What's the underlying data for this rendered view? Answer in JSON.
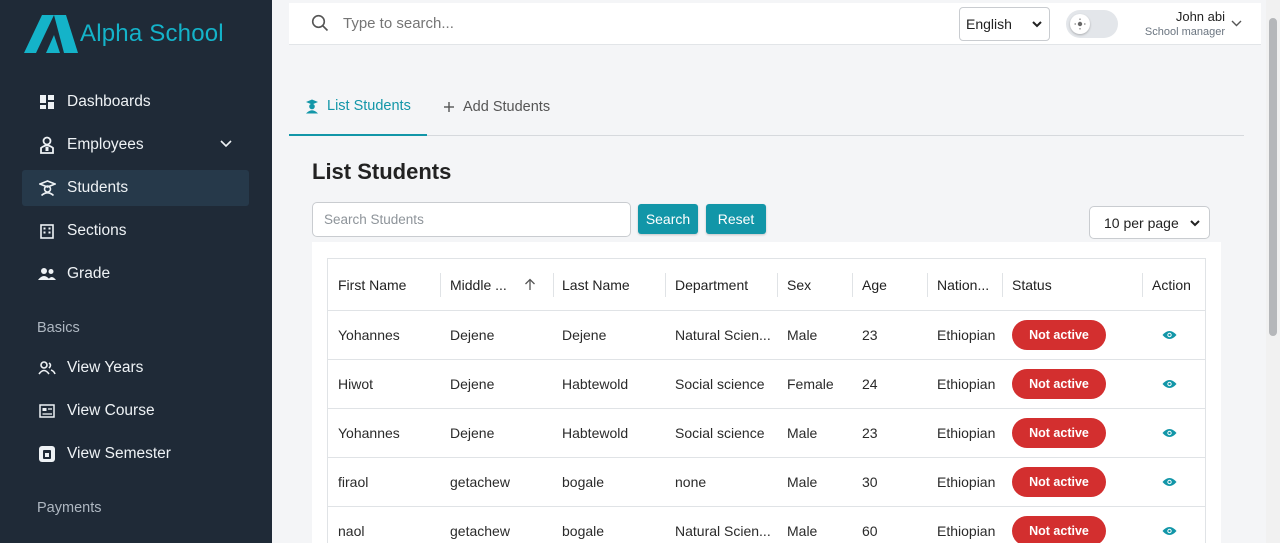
{
  "app": {
    "name": "Alpha School"
  },
  "sidebar": {
    "items": [
      {
        "label": "Dashboards",
        "icon": "dashboard-icon"
      },
      {
        "label": "Employees",
        "icon": "employee-icon"
      },
      {
        "label": "Students",
        "icon": "student-icon"
      },
      {
        "label": "Sections",
        "icon": "building-icon"
      },
      {
        "label": "Grade",
        "icon": "group-icon"
      }
    ],
    "basics_label": "Basics",
    "basics_items": [
      {
        "label": "View Years",
        "icon": "people-icon"
      },
      {
        "label": "View Course",
        "icon": "course-icon"
      },
      {
        "label": "View Semester",
        "icon": "semester-icon"
      }
    ],
    "payments_label": "Payments"
  },
  "topbar": {
    "search_placeholder": "Type to search...",
    "language": "English",
    "user_name": "John abi",
    "user_role": "School manager"
  },
  "tabs": {
    "list": "List Students",
    "add": "Add Students"
  },
  "page": {
    "title": "List Students",
    "search_placeholder": "Search Students",
    "search_button": "Search",
    "reset_button": "Reset",
    "per_page": "10 per page"
  },
  "table": {
    "headers": [
      "First Name",
      "Middle ...",
      "Last Name",
      "Department",
      "Sex",
      "Age",
      "Nation...",
      "Status",
      "Action"
    ],
    "rows": [
      {
        "first": "Yohannes",
        "middle": "Dejene",
        "last": "Dejene",
        "dept": "Natural Scien...",
        "sex": "Male",
        "age": "23",
        "nation": "Ethiopian",
        "status": "Not active"
      },
      {
        "first": "Hiwot",
        "middle": "Dejene",
        "last": "Habtewold",
        "dept": "Social science",
        "sex": "Female",
        "age": "24",
        "nation": "Ethiopian",
        "status": "Not active"
      },
      {
        "first": "Yohannes",
        "middle": "Dejene",
        "last": "Habtewold",
        "dept": "Social science",
        "sex": "Male",
        "age": "23",
        "nation": "Ethiopian",
        "status": "Not active"
      },
      {
        "first": "firaol",
        "middle": "getachew",
        "last": "bogale",
        "dept": "none",
        "sex": "Male",
        "age": "30",
        "nation": "Ethiopian",
        "status": "Not active"
      },
      {
        "first": "naol",
        "middle": "getachew",
        "last": "bogale",
        "dept": "Natural Scien...",
        "sex": "Male",
        "age": "60",
        "nation": "Ethiopian",
        "status": "Not active"
      }
    ]
  },
  "colors": {
    "accent": "#1296a8",
    "sidebar": "#1f2a37",
    "badge": "#d32f2f"
  }
}
